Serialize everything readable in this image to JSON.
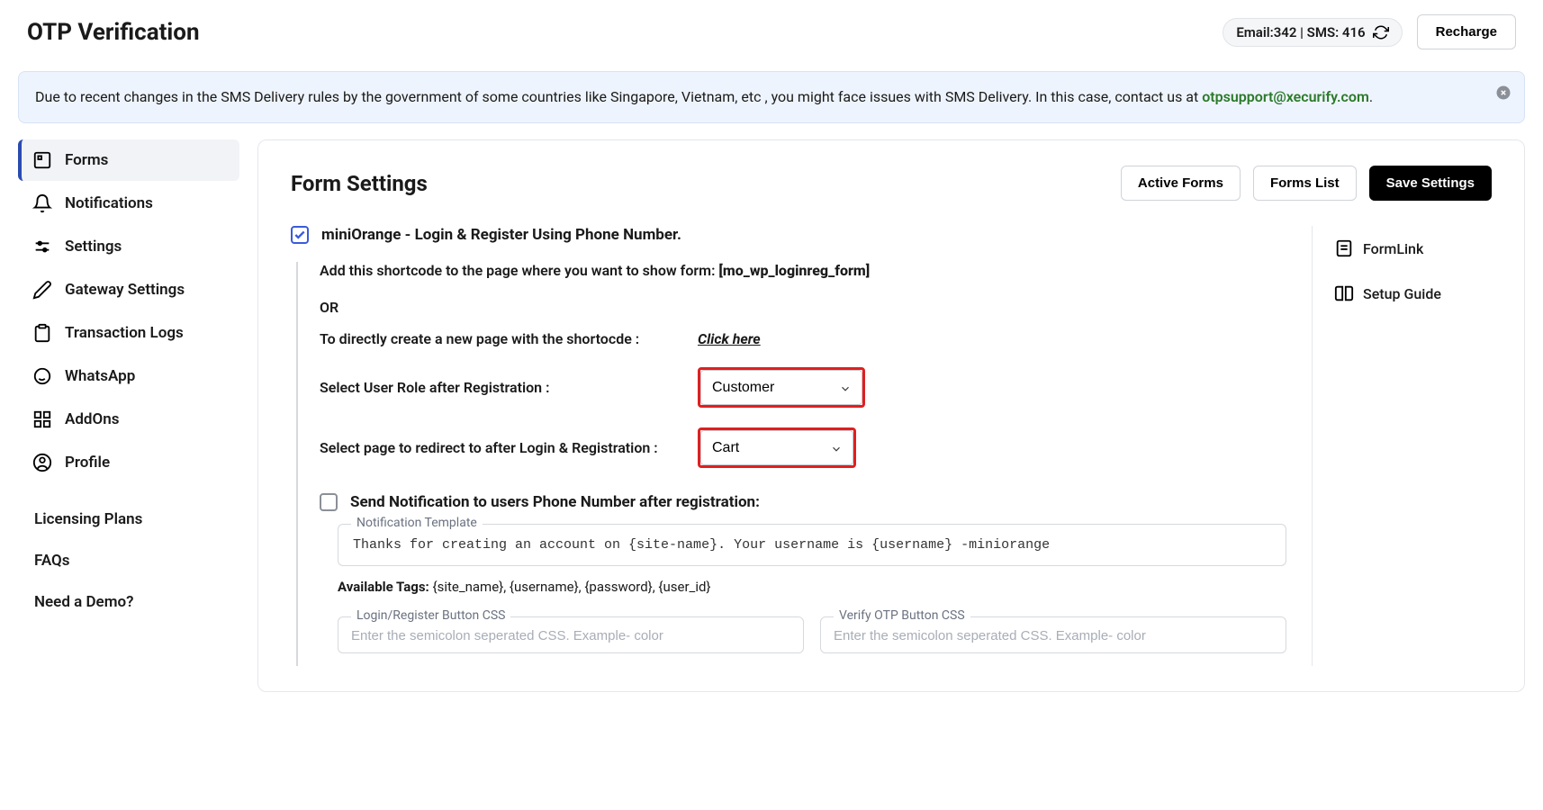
{
  "header": {
    "title": "OTP Verification",
    "status": "Email:342 | SMS: 416",
    "recharge": "Recharge"
  },
  "alert": {
    "text": "Due to recent changes in the SMS Delivery rules by the government of some countries like Singapore, Vietnam, etc , you might face issues with SMS Delivery. In this case, contact us at ",
    "email": "otpsupport@xecurify.com",
    "suffix": "."
  },
  "sidebar": {
    "items": [
      {
        "label": "Forms"
      },
      {
        "label": "Notifications"
      },
      {
        "label": "Settings"
      },
      {
        "label": "Gateway Settings"
      },
      {
        "label": "Transaction Logs"
      },
      {
        "label": "WhatsApp"
      },
      {
        "label": "AddOns"
      },
      {
        "label": "Profile"
      }
    ],
    "secondary": [
      {
        "label": "Licensing Plans"
      },
      {
        "label": "FAQs"
      },
      {
        "label": "Need a Demo?"
      }
    ]
  },
  "main": {
    "title": "Form Settings",
    "buttons": {
      "active": "Active Forms",
      "list": "Forms List",
      "save": "Save Settings"
    }
  },
  "form": {
    "title": "miniOrange - Login & Register Using Phone Number.",
    "shortcode_prefix": "Add this shortcode to the page where you want to show form: ",
    "shortcode": "[mo_wp_loginreg_form]",
    "or": "OR",
    "create_page": "To directly create a new page with the shortocde :",
    "click_here": "Click here",
    "role_label": "Select User Role after Registration :",
    "role_value": "Customer",
    "redirect_label": "Select page to redirect to after Login & Registration :",
    "redirect_value": "Cart",
    "notif_label": "Send Notification to users Phone Number after registration:",
    "template_label": "Notification Template",
    "template_text": "Thanks for creating an account on {site-name}. Your username is {username} -miniorange",
    "tags_label": "Available Tags: ",
    "tags_list": "{site_name}, {username}, {password}, {user_id}",
    "css_login_label": "Login/Register Button CSS",
    "css_verify_label": "Verify OTP Button CSS",
    "css_placeholder": "Enter the semicolon seperated CSS. Example- color"
  },
  "rail": {
    "formlink": "FormLink",
    "setup": "Setup Guide"
  }
}
